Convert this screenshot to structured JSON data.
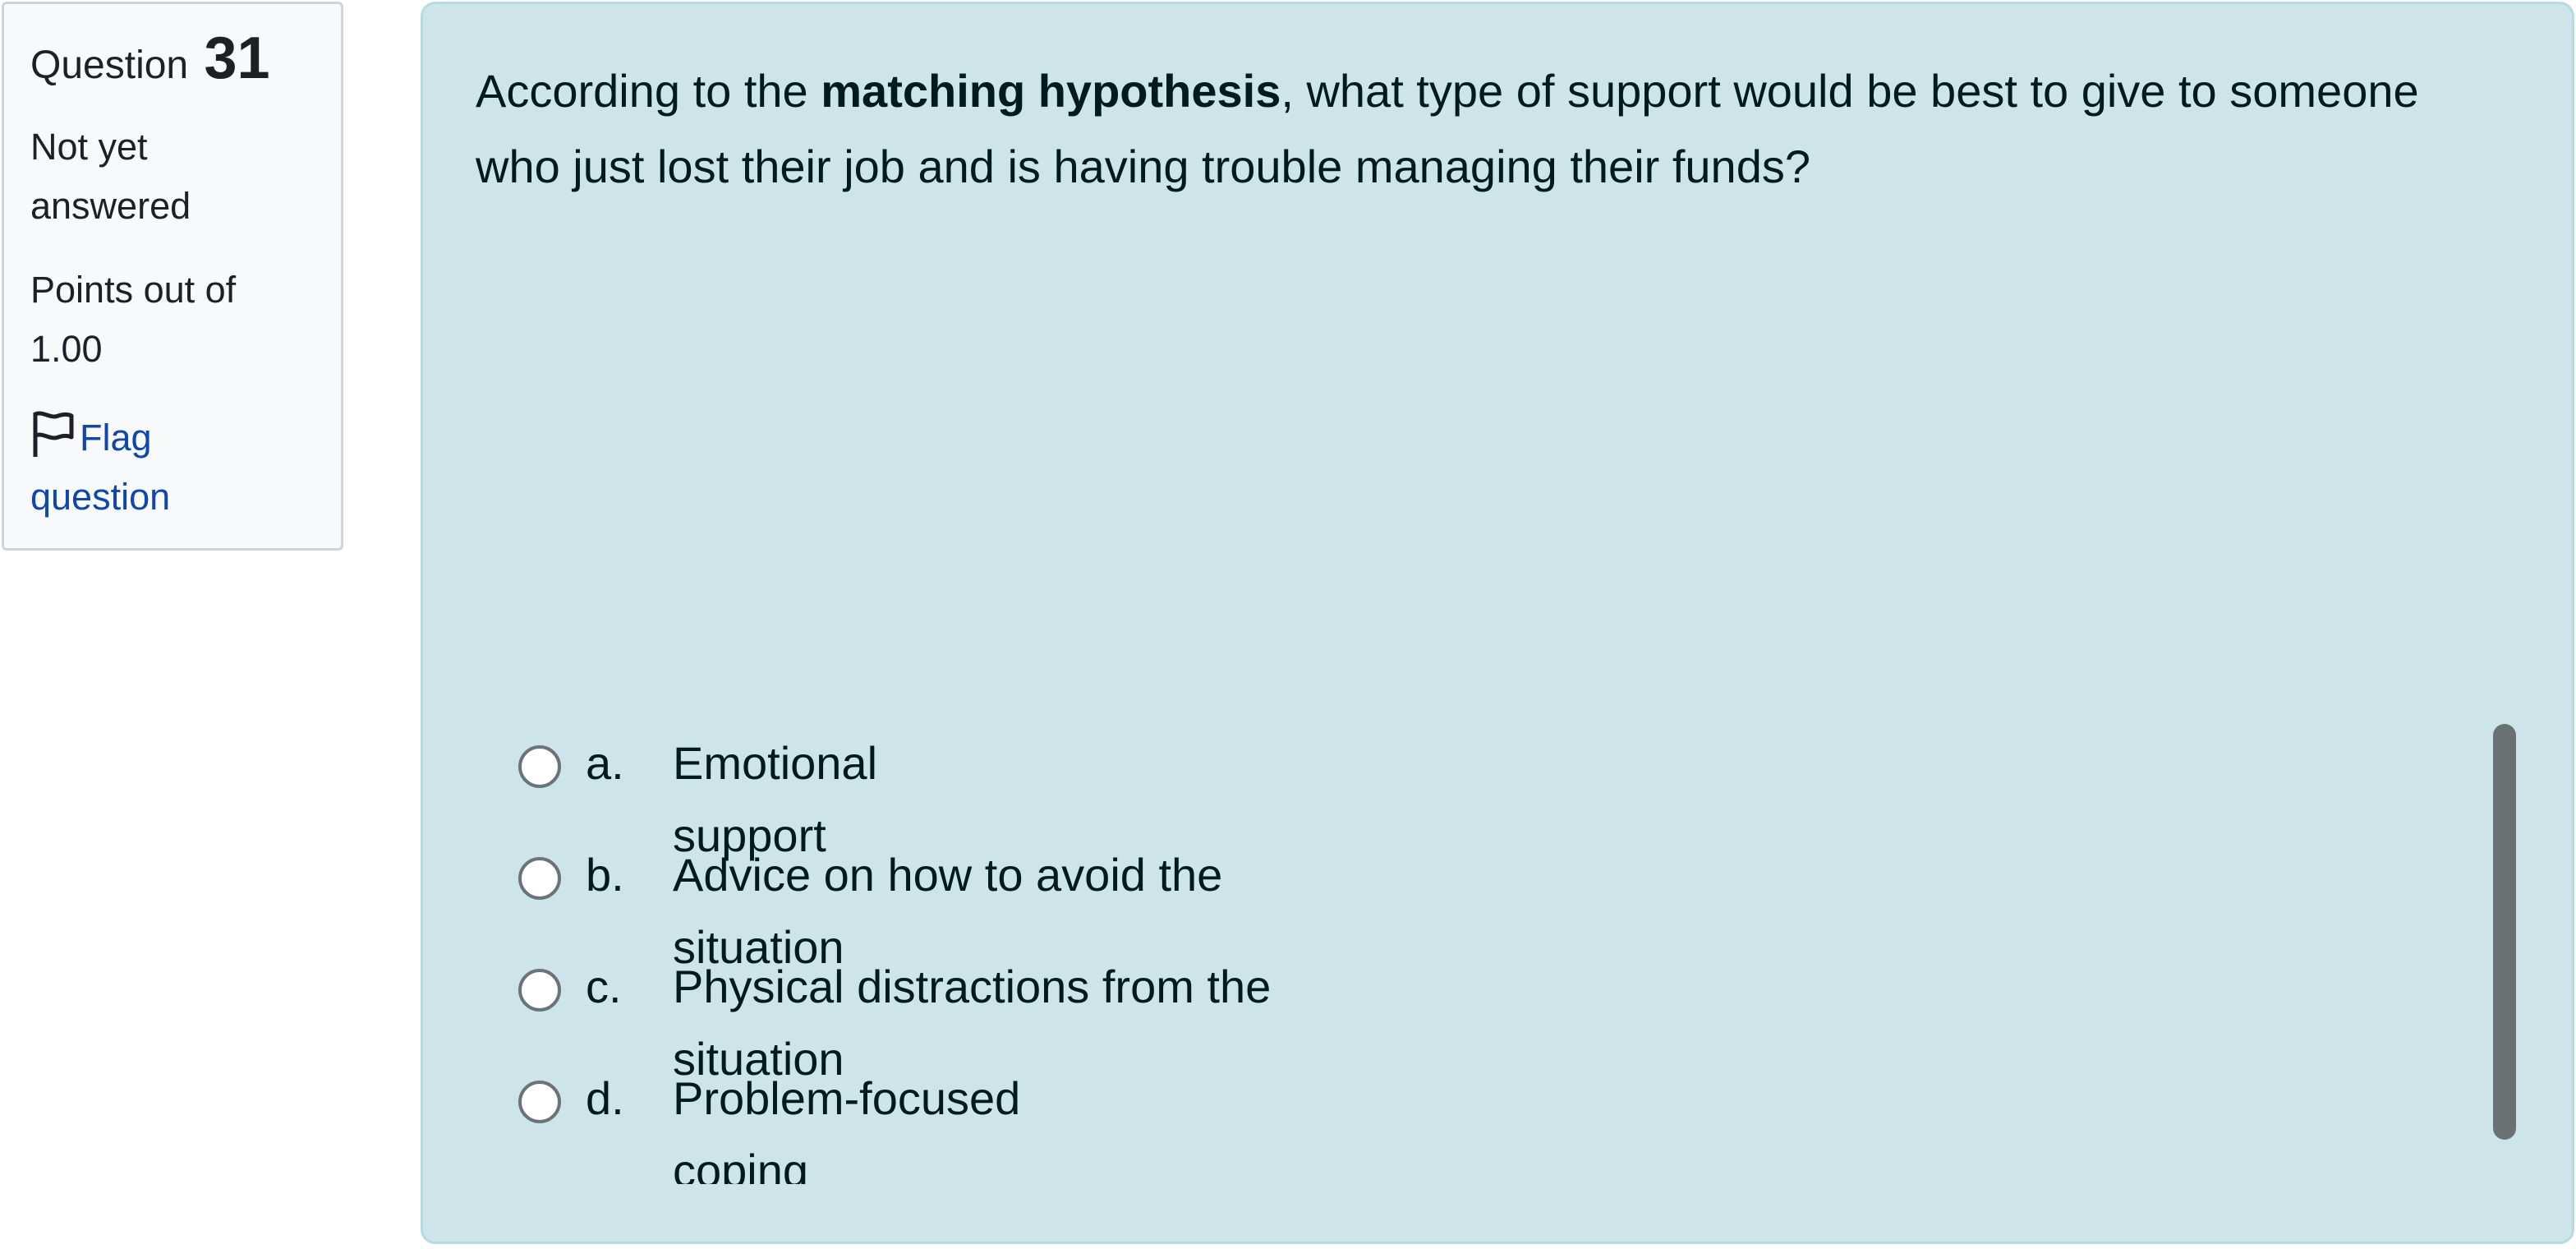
{
  "info": {
    "question_label": "Question",
    "question_number": "31",
    "state": "Not yet answered",
    "grade": "Points out of 1.00",
    "flag_label": "Flag question"
  },
  "question": {
    "text_before": "According to the ",
    "text_bold": "matching hypothesis",
    "text_after": ", what type of support would be best to give to someone who just lost their job and is having trouble managing their funds?"
  },
  "answers": [
    {
      "letter": "a.",
      "line1": "Emotional",
      "line2": "support"
    },
    {
      "letter": "b.",
      "line1": "Advice on how to avoid the",
      "line2": "situation"
    },
    {
      "letter": "c.",
      "line1": "Physical distractions from the",
      "line2": "situation"
    },
    {
      "letter": "d.",
      "line1": "Problem-focused",
      "line2": "coping"
    }
  ],
  "colors": {
    "panel_bg": "#cde5e9",
    "link": "#0f47ad",
    "scrollbar": "#6a7173"
  }
}
